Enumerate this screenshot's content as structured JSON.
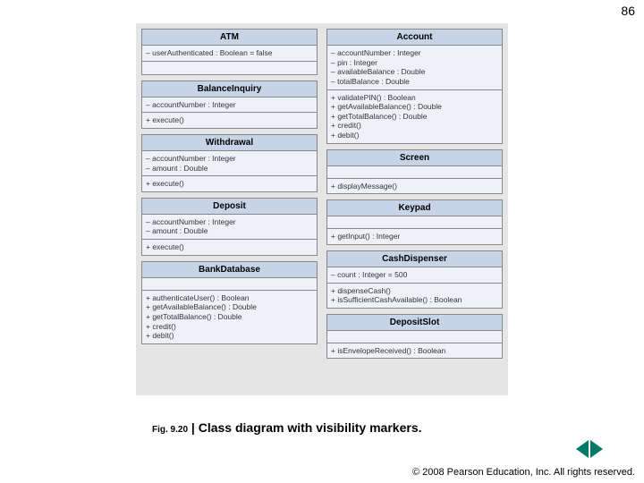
{
  "page_number": "86",
  "caption": {
    "fig_num": "Fig. 9.20",
    "separator": " | ",
    "text": "Class diagram with visibility markers."
  },
  "footer": "© 2008 Pearson Education, Inc.  All rights reserved.",
  "columns": [
    [
      {
        "name": "ATM",
        "attrs": [
          "– userAuthenticated : Boolean = false"
        ],
        "ops": []
      },
      {
        "name": "BalanceInquiry",
        "attrs": [
          "– accountNumber : Integer"
        ],
        "ops": [
          "+ execute()"
        ]
      },
      {
        "name": "Withdrawal",
        "attrs": [
          "– accountNumber : Integer",
          "– amount : Double"
        ],
        "ops": [
          "+ execute()"
        ]
      },
      {
        "name": "Deposit",
        "attrs": [
          "– accountNumber : Integer",
          "– amount : Double"
        ],
        "ops": [
          "+ execute()"
        ]
      },
      {
        "name": "BankDatabase",
        "attrs": [],
        "ops": [
          "+ authenticateUser() : Boolean",
          "+ getAvailableBalance() : Double",
          "+ getTotalBalance() : Double",
          "+ credit()",
          "+ debit()"
        ]
      }
    ],
    [
      {
        "name": "Account",
        "attrs": [
          "– accountNumber : Integer",
          "– pin : Integer",
          "– availableBalance : Double",
          "– totalBalance : Double"
        ],
        "ops": [
          "+ validatePIN() : Boolean",
          "+ getAvailableBalance() : Double",
          "+ getTotalBalance() : Double",
          "+ credit()",
          "+ debit()"
        ]
      },
      {
        "name": "Screen",
        "attrs": [],
        "ops": [
          "+ displayMessage()"
        ]
      },
      {
        "name": "Keypad",
        "attrs": [],
        "ops": [
          "+ getInput() : Integer"
        ]
      },
      {
        "name": "CashDispenser",
        "attrs": [
          "– count : Integer = 500"
        ],
        "ops": [
          "+ dispenseCash()",
          "+ isSufficientCashAvailable() : Boolean"
        ]
      },
      {
        "name": "DepositSlot",
        "attrs": [],
        "ops": [
          "+ isEnvelopeReceived() : Boolean"
        ]
      }
    ]
  ]
}
